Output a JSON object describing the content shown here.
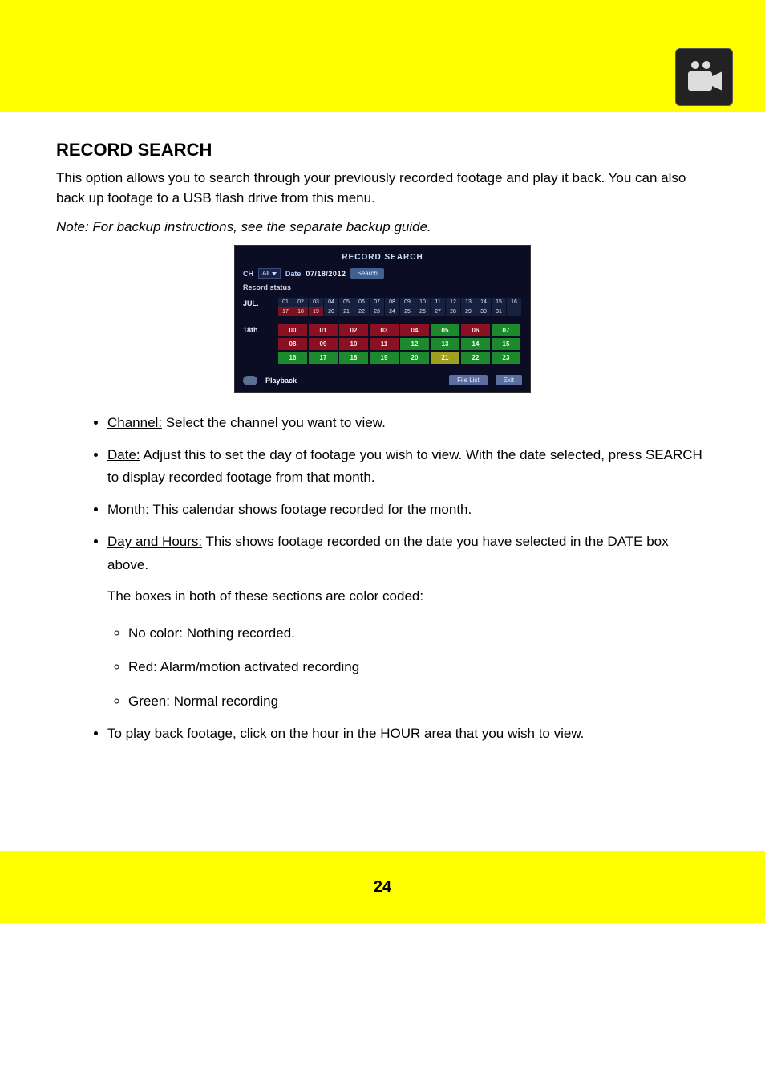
{
  "header": {
    "icon_name": "camera-icon"
  },
  "section": {
    "title": "RECORD SEARCH",
    "intro": "This option allows you to search through your previously recorded footage and play it back. You can also back up footage to a USB flash drive from this menu.",
    "note": "Note: For backup instructions, see the separate backup guide."
  },
  "screenshot": {
    "title": "RECORD SEARCH",
    "ch_label": "CH",
    "ch_value": "All",
    "date_label": "Date",
    "date_value": "07/18/2012",
    "search_btn": "Search",
    "record_status_label": "Record status",
    "month_label": "JUL.",
    "day_label": "18th",
    "cal_row1": [
      "01",
      "02",
      "03",
      "04",
      "05",
      "06",
      "07",
      "08",
      "09",
      "10",
      "11",
      "12",
      "13",
      "14",
      "15",
      "16"
    ],
    "cal_row2": [
      "17",
      "18",
      "19",
      "20",
      "21",
      "22",
      "23",
      "24",
      "25",
      "26",
      "27",
      "28",
      "29",
      "30",
      "31",
      ""
    ],
    "cal_highlight": [
      17,
      18,
      19
    ],
    "hours_row1": [
      {
        "v": "00",
        "c": "red"
      },
      {
        "v": "01",
        "c": "red"
      },
      {
        "v": "02",
        "c": "red"
      },
      {
        "v": "03",
        "c": "red"
      },
      {
        "v": "04",
        "c": "red"
      },
      {
        "v": "05",
        "c": "green"
      },
      {
        "v": "06",
        "c": "red"
      },
      {
        "v": "07",
        "c": "green"
      }
    ],
    "hours_row2": [
      {
        "v": "08",
        "c": "red"
      },
      {
        "v": "09",
        "c": "red"
      },
      {
        "v": "10",
        "c": "red"
      },
      {
        "v": "11",
        "c": "red"
      },
      {
        "v": "12",
        "c": "green"
      },
      {
        "v": "13",
        "c": "green"
      },
      {
        "v": "14",
        "c": "green"
      },
      {
        "v": "15",
        "c": "green"
      }
    ],
    "hours_row3": [
      {
        "v": "16",
        "c": "green"
      },
      {
        "v": "17",
        "c": "green"
      },
      {
        "v": "18",
        "c": "green"
      },
      {
        "v": "19",
        "c": "green"
      },
      {
        "v": "20",
        "c": "green"
      },
      {
        "v": "21",
        "c": "yellow"
      },
      {
        "v": "22",
        "c": "green"
      },
      {
        "v": "23",
        "c": "green"
      }
    ],
    "playback_label": "Playback",
    "file_list_btn": "File List",
    "exit_btn": "Exit"
  },
  "bullets": {
    "channel": {
      "label": "Channel:",
      "text": " Select the channel you want to view."
    },
    "date": {
      "label": "Date:",
      "text_part1": " Adjust this to set the day of footage you wish to view. With the date selected, press ",
      "search_term": "SEARCH",
      "text_part2": " to display recorded footage from that month."
    },
    "month": {
      "label": "Month:",
      "text": " This calendar shows footage recorded for the month."
    },
    "day": {
      "label": "Day and Hours:",
      "text": " This shows footage recorded on the date you have selected in the DATE box above.",
      "legend_intro": "The boxes in both of these sections are color coded:",
      "legend": {
        "none": "No color: Nothing recorded.",
        "alarm": "Red: Alarm/motion activated recording",
        "normal": "Green: Normal recording"
      }
    },
    "play": {
      "text_part1": "To play back footage, click on the hour in the ",
      "hour_term": "HOUR",
      "text_part2": " area that you wish to view."
    }
  },
  "footer": {
    "page_number": "24"
  }
}
